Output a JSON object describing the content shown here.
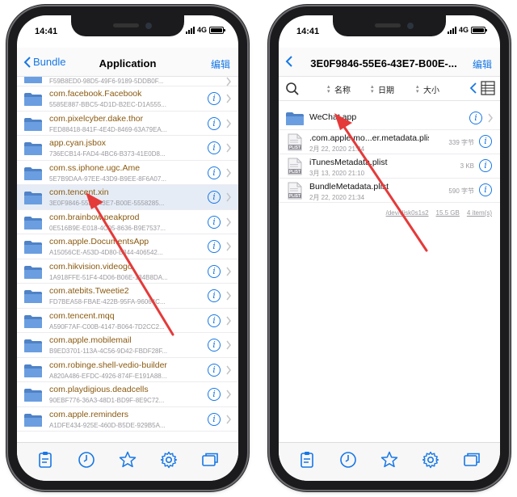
{
  "left": {
    "status": {
      "time": "14:41",
      "network": "4G"
    },
    "nav": {
      "back_label": "Bundle",
      "title": "Application",
      "edit_label": "编辑"
    },
    "partial_row": {
      "subtitle": "F59B8ED0-98D5-49F6-9189-5DDB0F..."
    },
    "rows": [
      {
        "name": "com.facebook.Facebook",
        "subtitle": "5585E887-BBC5-4D1D-B2EC-D1A555..."
      },
      {
        "name": "com.pixelcyber.dake.thor",
        "subtitle": "FED88418-841F-4E4D-8469-63A79EA..."
      },
      {
        "name": "app.cyan.jsbox",
        "subtitle": "736ECB14-FAD4-4BC6-B373-41E0D8..."
      },
      {
        "name": "com.ss.iphone.ugc.Ame",
        "subtitle": "5E7B9DAA-97EE-43D9-B9EE-8F6A07..."
      },
      {
        "name": "com.tencent.xin",
        "subtitle": "3E0F9846-55E6-43E7-B00E-5558285...",
        "selected": true
      },
      {
        "name": "com.brainbow.peakprod",
        "subtitle": "0E516B9E-E018-4C05-8636-B9E7537..."
      },
      {
        "name": "com.apple.DocumentsApp",
        "subtitle": "A15056CE-A53D-4D80-B344-406542..."
      },
      {
        "name": "com.hikvision.videogo",
        "subtitle": "1A918FFE-51F4-4D06-B06E-134B8DA..."
      },
      {
        "name": "com.atebits.Tweetie2",
        "subtitle": "FD7BEA58-FBAE-422B-95FA-96064C..."
      },
      {
        "name": "com.tencent.mqq",
        "subtitle": "A590F7AF-C00B-4147-B064-7D2CC2..."
      },
      {
        "name": "com.apple.mobilemail",
        "subtitle": "B9ED3701-113A-4C56-9D42-FBDF28F..."
      },
      {
        "name": "com.robinge.shell-vedio-builder",
        "subtitle": "A820A486-EFDC-4926-874F-E191A88..."
      },
      {
        "name": "com.playdigious.deadcells",
        "subtitle": "90EBF776-36A3-48D1-BD9F-8E9C72..."
      },
      {
        "name": "com.apple.reminders",
        "subtitle": "A1DFE434-925E-460D-B5DE-929B5A..."
      }
    ],
    "tabs": [
      "clipboard-icon",
      "clock-icon",
      "star-icon",
      "gear-icon",
      "windows-icon"
    ]
  },
  "right": {
    "status": {
      "time": "14:41",
      "network": "4G"
    },
    "nav": {
      "title": "3E0F9846-55E6-43E7-B00E-...",
      "edit_label": "编辑"
    },
    "sort": {
      "name": "名称",
      "date": "日期",
      "size": "大小"
    },
    "folder": {
      "name": "WeChat.app"
    },
    "files": [
      {
        "name": ".com.apple.mo...er.metadata.plist",
        "date": "2月 22, 2020 21:34",
        "size": "339 字节"
      },
      {
        "name": "iTunesMetadata.plist",
        "date": "3月 13, 2020 21:10",
        "size": "3 KB"
      },
      {
        "name": "BundleMetadata.plist",
        "date": "2月 22, 2020 21:34",
        "size": "590 字节"
      }
    ],
    "footer": {
      "device": "/dev/disk0s1s2",
      "free": "15.5 GB",
      "count": "4 item(s)"
    },
    "tabs": [
      "clipboard-icon",
      "clock-icon",
      "star-icon",
      "gear-icon",
      "windows-icon"
    ]
  },
  "colors": {
    "accent": "#1677e6",
    "annotation_arrow": "#e53a3a",
    "folder": "#5b8fd1",
    "bundle_text": "#8a5a10"
  }
}
